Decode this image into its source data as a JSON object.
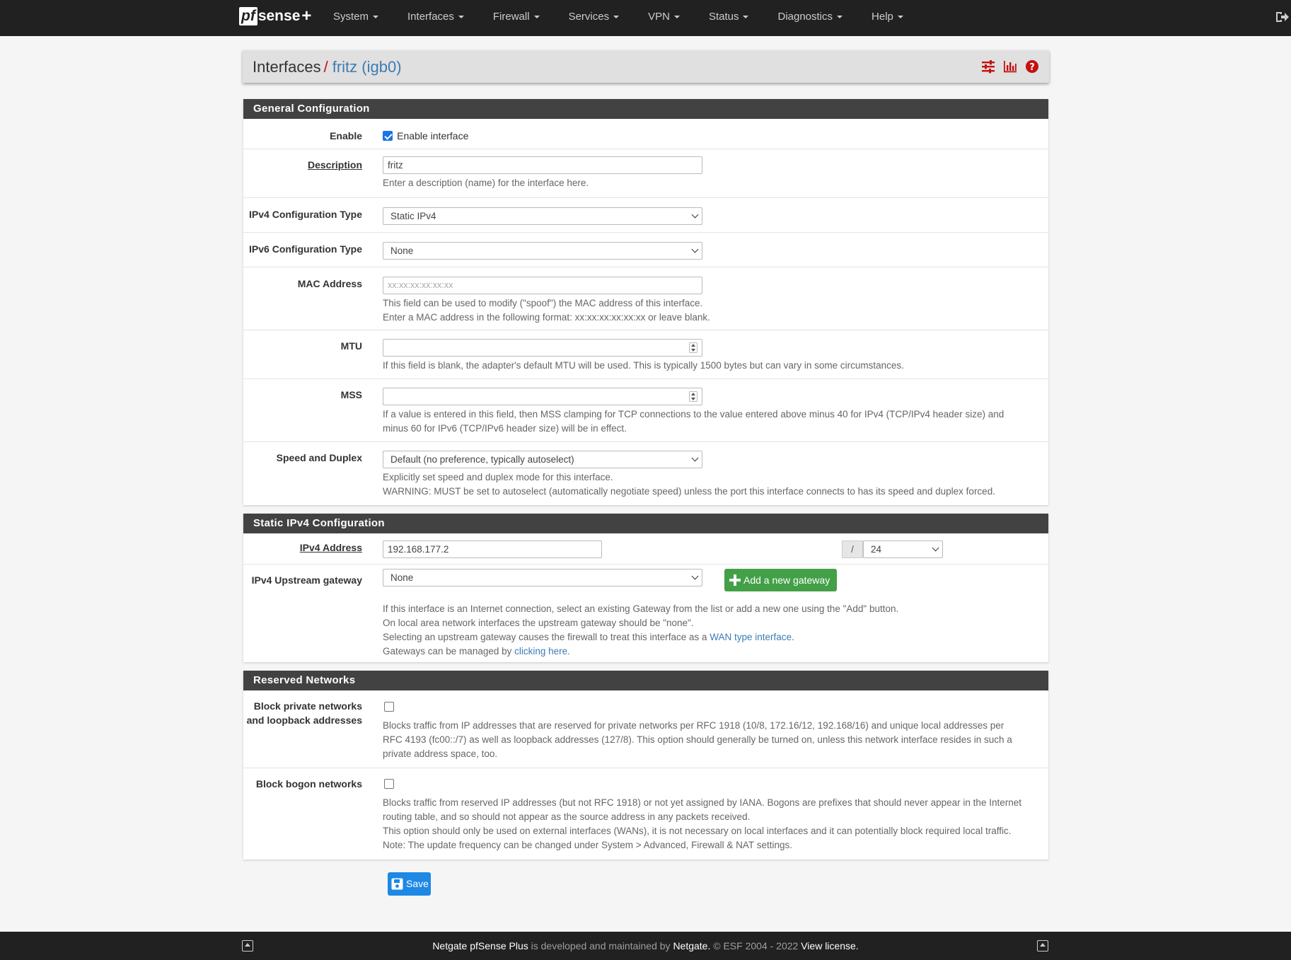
{
  "nav": {
    "brand_pf": "pf",
    "brand_sense": "sense",
    "brand_plus": "+",
    "items": [
      "System",
      "Interfaces",
      "Firewall",
      "Services",
      "VPN",
      "Status",
      "Diagnostics",
      "Help"
    ],
    "logout_icon": "sign-out-icon"
  },
  "breadcrumb": {
    "root": "Interfaces",
    "separator": "/",
    "current": "fritz (igb0)",
    "icons": [
      "sliders-icon",
      "bar-chart-icon",
      "help-circle-icon"
    ],
    "icon_color": "#c41111"
  },
  "general": {
    "heading": "General Configuration",
    "enable_label": "Enable",
    "enable_checkbox_label": "Enable interface",
    "enable_checked": true,
    "description_label": "Description",
    "description_value": "fritz",
    "description_help": "Enter a description (name) for the interface here.",
    "ipv4_type_label": "IPv4 Configuration Type",
    "ipv4_type_value": "Static IPv4",
    "ipv6_type_label": "IPv6 Configuration Type",
    "ipv6_type_value": "None",
    "mac_label": "MAC Address",
    "mac_placeholder": "xx:xx:xx:xx:xx:xx",
    "mac_help_1": "This field can be used to modify (\"spoof\") the MAC address of this interface.",
    "mac_help_2": "Enter a MAC address in the following format: xx:xx:xx:xx:xx:xx or leave blank.",
    "mtu_label": "MTU",
    "mtu_value": "",
    "mtu_help": "If this field is blank, the adapter's default MTU will be used. This is typically 1500 bytes but can vary in some circumstances.",
    "mss_label": "MSS",
    "mss_value": "",
    "mss_help_1": "If a value is entered in this field, then MSS clamping for TCP connections to the value entered above minus 40 for IPv4 (TCP/IPv4 header size) and",
    "mss_help_2": "minus 60 for IPv6 (TCP/IPv6 header size) will be in effect.",
    "speed_label": "Speed and Duplex",
    "speed_value": "Default (no preference, typically autoselect)",
    "speed_help_1": "Explicitly set speed and duplex mode for this interface.",
    "speed_help_2": "WARNING: MUST be set to autoselect (automatically negotiate speed) unless the port this interface connects to has its speed and duplex forced."
  },
  "static_ipv4": {
    "heading": "Static IPv4 Configuration",
    "address_label": "IPv4 Address",
    "address_value": "192.168.177.2",
    "cidr_sep": "/",
    "cidr_value": "24",
    "gateway_label": "IPv4 Upstream gateway",
    "gateway_value": "None",
    "add_gateway_button": "Add a new gateway",
    "help_1": "If this interface is an Internet connection, select an existing Gateway from the list or add a new one using the \"Add\" button.",
    "help_2": "On local area network interfaces the upstream gateway should be \"none\".",
    "help_3_pre": "Selecting an upstream gateway causes the firewall to treat this interface as a ",
    "help_3_link": "WAN type interface",
    "help_3_post": ".",
    "help_4_pre": "Gateways can be managed by ",
    "help_4_link": "clicking here",
    "help_4_post": "."
  },
  "reserved": {
    "heading": "Reserved Networks",
    "private_label_1": "Block private networks",
    "private_label_2": "and loopback addresses",
    "private_checked": false,
    "private_help_1": "Blocks traffic from IP addresses that are reserved for private networks per RFC 1918 (10/8, 172.16/12, 192.168/16) and unique local addresses per",
    "private_help_2": "RFC 4193 (fc00::/7) as well as loopback addresses (127/8). This option should generally be turned on, unless this network interface resides in such a",
    "private_help_3": "private address space, too.",
    "bogon_label": "Block bogon networks",
    "bogon_checked": false,
    "bogon_help_1": "Blocks traffic from reserved IP addresses (but not RFC 1918) or not yet assigned by IANA. Bogons are prefixes that should never appear in the Internet",
    "bogon_help_2": "routing table, and so should not appear as the source address in any packets received.",
    "bogon_help_3": "This option should only be used on external interfaces (WANs), it is not necessary on local interfaces and it can potentially block required local traffic.",
    "bogon_help_4": "Note: The update frequency can be changed under System > Advanced, Firewall & NAT settings."
  },
  "save_button": "Save",
  "footer": {
    "product": "Netgate pfSense Plus",
    "middle": " is developed and maintained by ",
    "company": "Netgate.",
    "copyright": " © ESF 2004 - 2022 ",
    "license": "View license."
  },
  "colors": {
    "navbar": "#212121",
    "panel_heading": "#424242",
    "link": "#3c7bb5",
    "accent_red": "#c41111",
    "green_button": "#43a047",
    "save_button": "#1e88e5"
  }
}
